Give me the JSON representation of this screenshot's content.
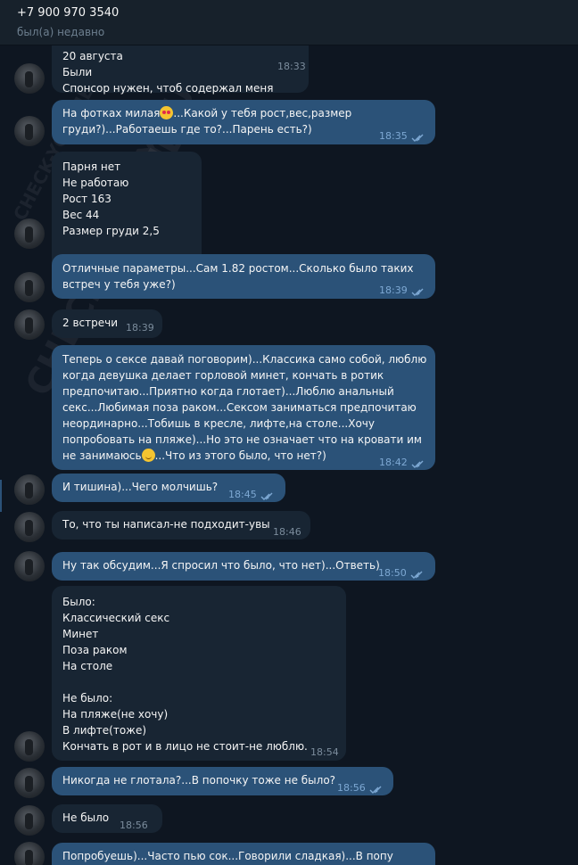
{
  "header": {
    "title": "+7 900 970 3540",
    "status": "был(а) недавно"
  },
  "watermark": "CHECK-YOU.ME",
  "messages": [
    {
      "from": "in",
      "text": "20 августа\nБыли\nСпонсор нужен, чтоб содержал меня",
      "time": "18:33"
    },
    {
      "from": "out",
      "pre": "На фотках милая",
      "emoji": "heart-eyes",
      "text": "...Какой у тебя рост,вес,размер\nгруди?)...Работаешь где то?...Парень есть?)",
      "time": "18:35"
    },
    {
      "from": "in",
      "text": "Парня нет\nНе работаю\nРост 163\nВес 44\nРазмер груди 2,5",
      "time": "18:36"
    },
    {
      "from": "out",
      "text": "Отличные параметры...Сам 1.82 ростом...Сколько было таких\nвстреч у тебя уже?)",
      "time": "18:39"
    },
    {
      "from": "in",
      "text": "2 встречи",
      "time": "18:39"
    },
    {
      "from": "out",
      "text": "Теперь о сексе давай поговорим)...Классика само собой, люблю\nкогда девушка делает горловой минет, кончать в ротик\nпредпочитаю...Приятно когда глотает)...Люблю анальный\nсекс...Любимая поза раком...Сексом заниматься предпочитаю\nнеординарно...Тобишь в кресле, лифте,на столе...Хочу\nпопробовать на пляже)...Но это не означает что на кровати им",
      "last_pre": "не занимаюсь",
      "emoji": "smile",
      "last_post": "...Что из этого было, что нет?)",
      "time": "18:42"
    },
    {
      "from": "out",
      "text": "И тишина)...Чего молчишь?",
      "time": "18:45"
    },
    {
      "from": "in",
      "text": "То, что ты написал-не подходит-увы",
      "time": "18:46"
    },
    {
      "from": "out",
      "text": "Ну так обсудим...Я спросил что было, что нет)...Ответь)",
      "time": "18:50"
    },
    {
      "from": "in",
      "text": "Было:\nКлассический секс\nМинет\nПоза раком\nНа столе\n\nНе было:\nНа пляже(не хочу)\nВ лифте(тоже)\nКончать в рот и в лицо не стоит-не люблю.",
      "time": "18:54"
    },
    {
      "from": "out",
      "text": "Никогда не глотала?...В попочку тоже не было?",
      "time": "18:56"
    },
    {
      "from": "in",
      "text": "Не было",
      "time": "18:56"
    },
    {
      "from": "out",
      "text": "Попробуешь)...Часто пью сок...Говорили сладкая)...В попу",
      "time": ""
    }
  ]
}
